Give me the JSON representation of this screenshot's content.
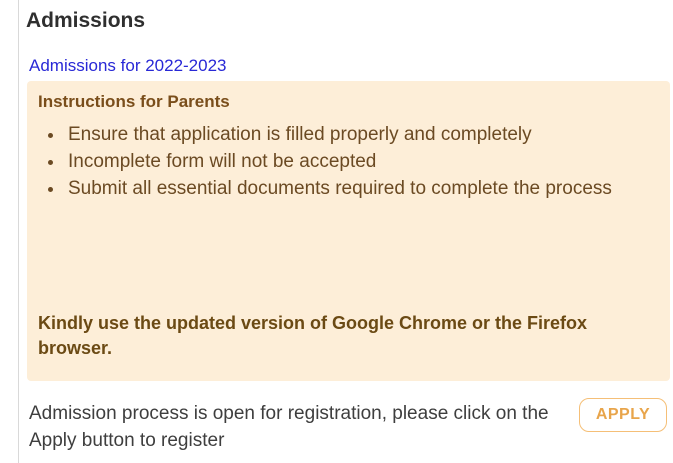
{
  "page": {
    "title": "Admissions",
    "year_link": "Admissions for 2022-2023"
  },
  "instructions": {
    "title": "Instructions for Parents",
    "items": [
      "Ensure that application is filled properly and completely",
      "Incomplete form will not be accepted",
      "Submit all essential documents required to complete the process"
    ],
    "browser_note": "Kindly use the updated version of Google Chrome or the Firefox browser."
  },
  "registration": {
    "message": "Admission process is open for registration, please click on the Apply button to register",
    "apply_label": "APPLY"
  },
  "colors": {
    "panel_background": "#fdeed8",
    "link": "#2828d6",
    "apply_accent": "#e8a54b"
  }
}
